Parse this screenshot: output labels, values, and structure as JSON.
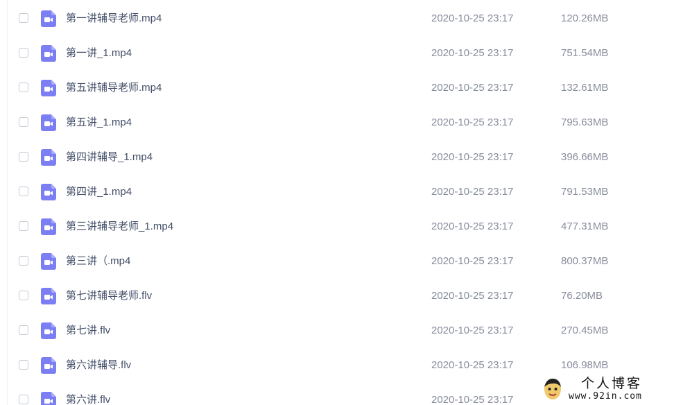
{
  "files": [
    {
      "name": "第一讲辅导老师.mp4",
      "date": "2020-10-25 23:17",
      "size": "120.26MB"
    },
    {
      "name": "第一讲_1.mp4",
      "date": "2020-10-25 23:17",
      "size": "751.54MB"
    },
    {
      "name": "第五讲辅导老师.mp4",
      "date": "2020-10-25 23:17",
      "size": "132.61MB"
    },
    {
      "name": "第五讲_1.mp4",
      "date": "2020-10-25 23:17",
      "size": "795.63MB"
    },
    {
      "name": "第四讲辅导_1.mp4",
      "date": "2020-10-25 23:17",
      "size": "396.66MB"
    },
    {
      "name": "第四讲_1.mp4",
      "date": "2020-10-25 23:17",
      "size": "791.53MB"
    },
    {
      "name": "第三讲辅导老师_1.mp4",
      "date": "2020-10-25 23:17",
      "size": "477.31MB"
    },
    {
      "name": "第三讲（.mp4",
      "date": "2020-10-25 23:17",
      "size": "800.37MB"
    },
    {
      "name": "第七讲辅导老师.flv",
      "date": "2020-10-25 23:17",
      "size": "76.20MB"
    },
    {
      "name": "第七讲.flv",
      "date": "2020-10-25 23:17",
      "size": "270.45MB"
    },
    {
      "name": "第六讲辅导.flv",
      "date": "2020-10-25 23:17",
      "size": "106.98MB"
    },
    {
      "name": "第六讲.flv",
      "date": "2020-10-25 23:17",
      "size": ""
    }
  ],
  "file_icon": "video-file-icon",
  "colors": {
    "icon_bg": "#7b7ff3",
    "name_text": "#424e67",
    "meta_text": "#878c9c",
    "checkbox_border": "#c4c8d0"
  },
  "watermark": {
    "title": "个人博客",
    "url": "www.92in.com"
  }
}
